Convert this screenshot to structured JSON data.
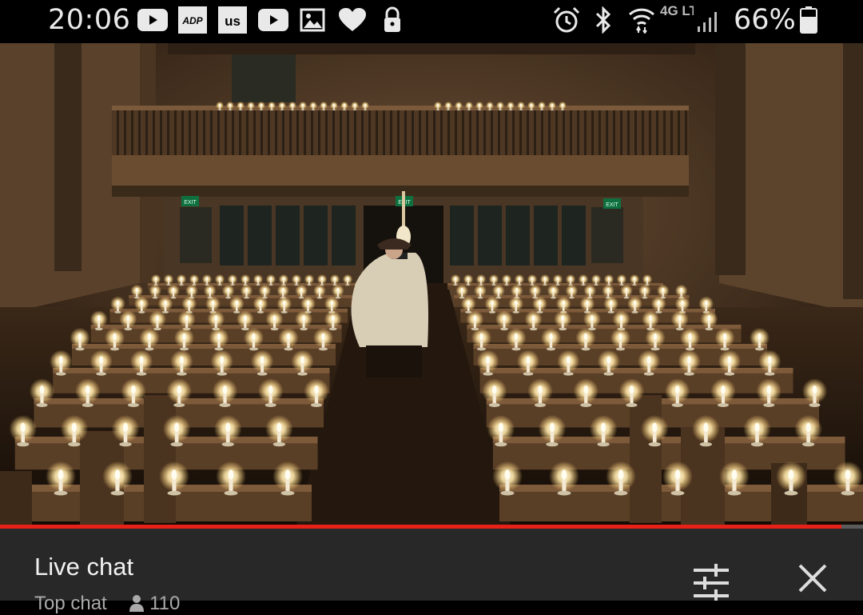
{
  "status_bar": {
    "time": "20:06",
    "network": "4G LTE",
    "battery_percent": "66%",
    "left_icons": [
      "youtube-icon",
      "adp-icon",
      "us-news-icon",
      "youtube-icon",
      "gallery-icon",
      "heart-icon",
      "lock-icon"
    ],
    "right_icons": [
      "alarm-icon",
      "bluetooth-icon",
      "wifi-icon",
      "signal-icon",
      "battery-icon"
    ],
    "app_badges": {
      "adp": "ADP",
      "us": "us"
    }
  },
  "video": {
    "exit_sign_text": "EXIT",
    "progress_fraction": 0.975,
    "accent_color": "#e62117"
  },
  "live_chat": {
    "title": "Live chat",
    "mode": "Top chat",
    "viewer_count": "110",
    "icons": [
      "filter-icon",
      "close-icon"
    ]
  }
}
